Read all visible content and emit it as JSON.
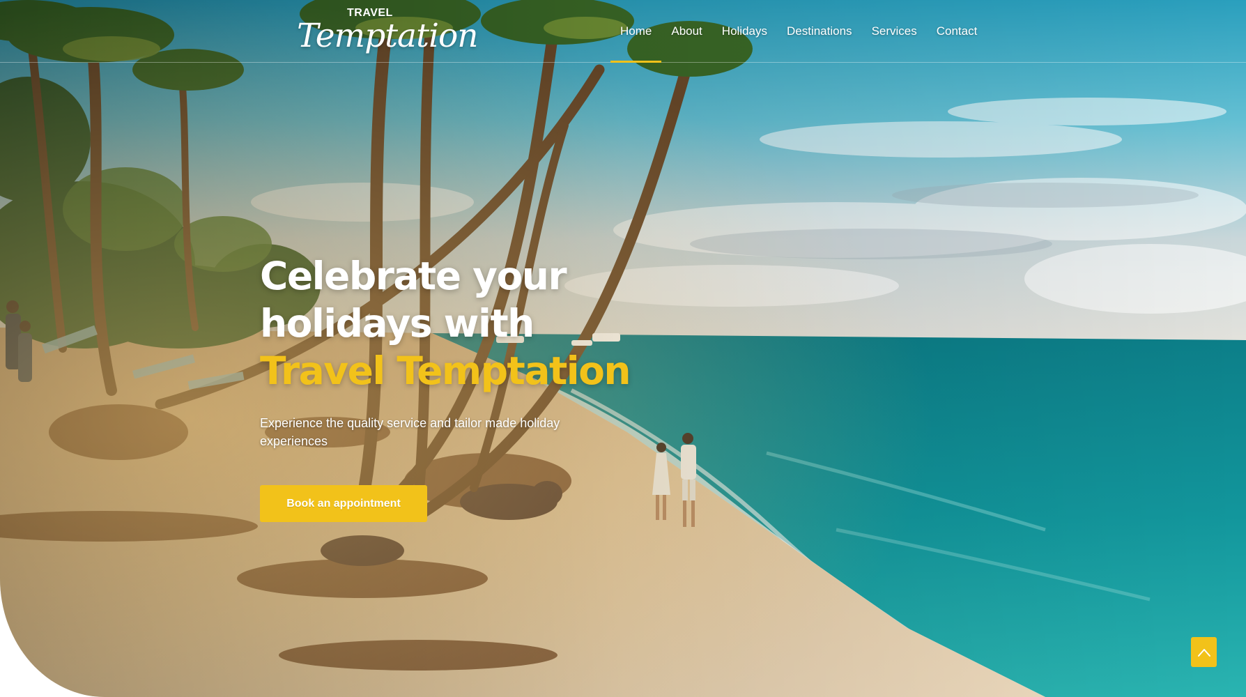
{
  "brand": {
    "logo_top": "TRAVEL",
    "logo_script": "Temptation"
  },
  "nav": {
    "items": [
      {
        "label": "Home",
        "active": true
      },
      {
        "label": "About",
        "active": false
      },
      {
        "label": "Holidays",
        "active": false
      },
      {
        "label": "Destinations",
        "active": false
      },
      {
        "label": "Services",
        "active": false
      },
      {
        "label": "Contact",
        "active": false
      }
    ]
  },
  "hero": {
    "headline_line1": "Celebrate your",
    "headline_line2": "holidays with",
    "headline_accent": "Travel Temptation",
    "subtext": "Experience the quality service and tailor made holiday experiences",
    "cta_label": "Book an appointment"
  },
  "icons": {
    "scroll_top": "chevron-up-icon"
  },
  "colors": {
    "accent": "#f2c21a",
    "text_light": "#ffffff",
    "sky": "#3fb3cc",
    "sea": "#138f98",
    "sand": "#e3c9a2"
  }
}
